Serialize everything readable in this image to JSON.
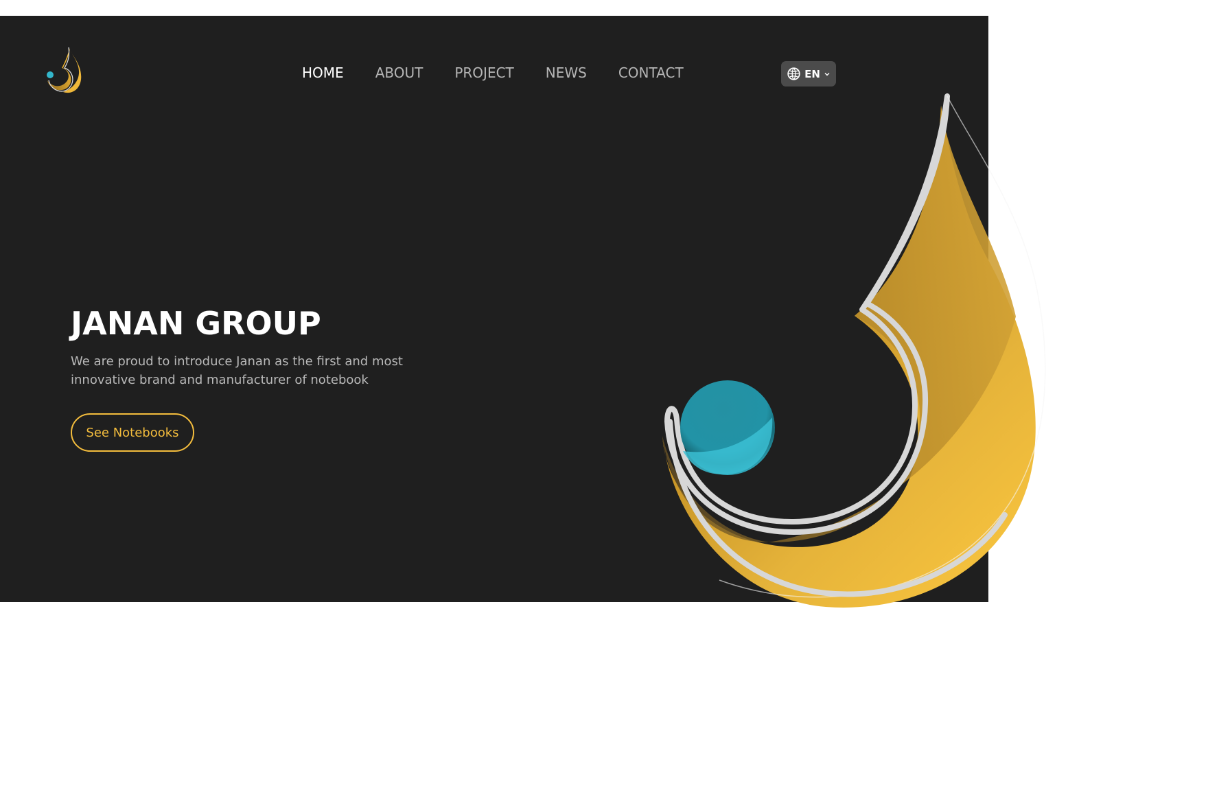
{
  "colors": {
    "hero_background": "#1f1f1f",
    "accent": "#f4bd3d",
    "teal": "#2fa8bd",
    "nav_active": "#ffffff",
    "nav_inactive": "#b5b5b5"
  },
  "header": {
    "logo_icon": "drop-logo-icon",
    "nav": [
      {
        "label": "HOME",
        "active": true
      },
      {
        "label": "ABOUT",
        "active": false
      },
      {
        "label": "PROJECT",
        "active": false
      },
      {
        "label": "NEWS",
        "active": false
      },
      {
        "label": "CONTACT",
        "active": false
      }
    ],
    "language": {
      "label": "EN",
      "icon": "globe-icon",
      "dropdown_icon": "chevron-down-icon"
    }
  },
  "hero": {
    "title": "JANAN GROUP",
    "description_line_1": "We are proud to introduce Janan as the first and most",
    "description_line_2": "innovative brand and manufacturer of notebook",
    "button_label": "See Notebooks",
    "artwork": "janan-drop-artwork"
  }
}
